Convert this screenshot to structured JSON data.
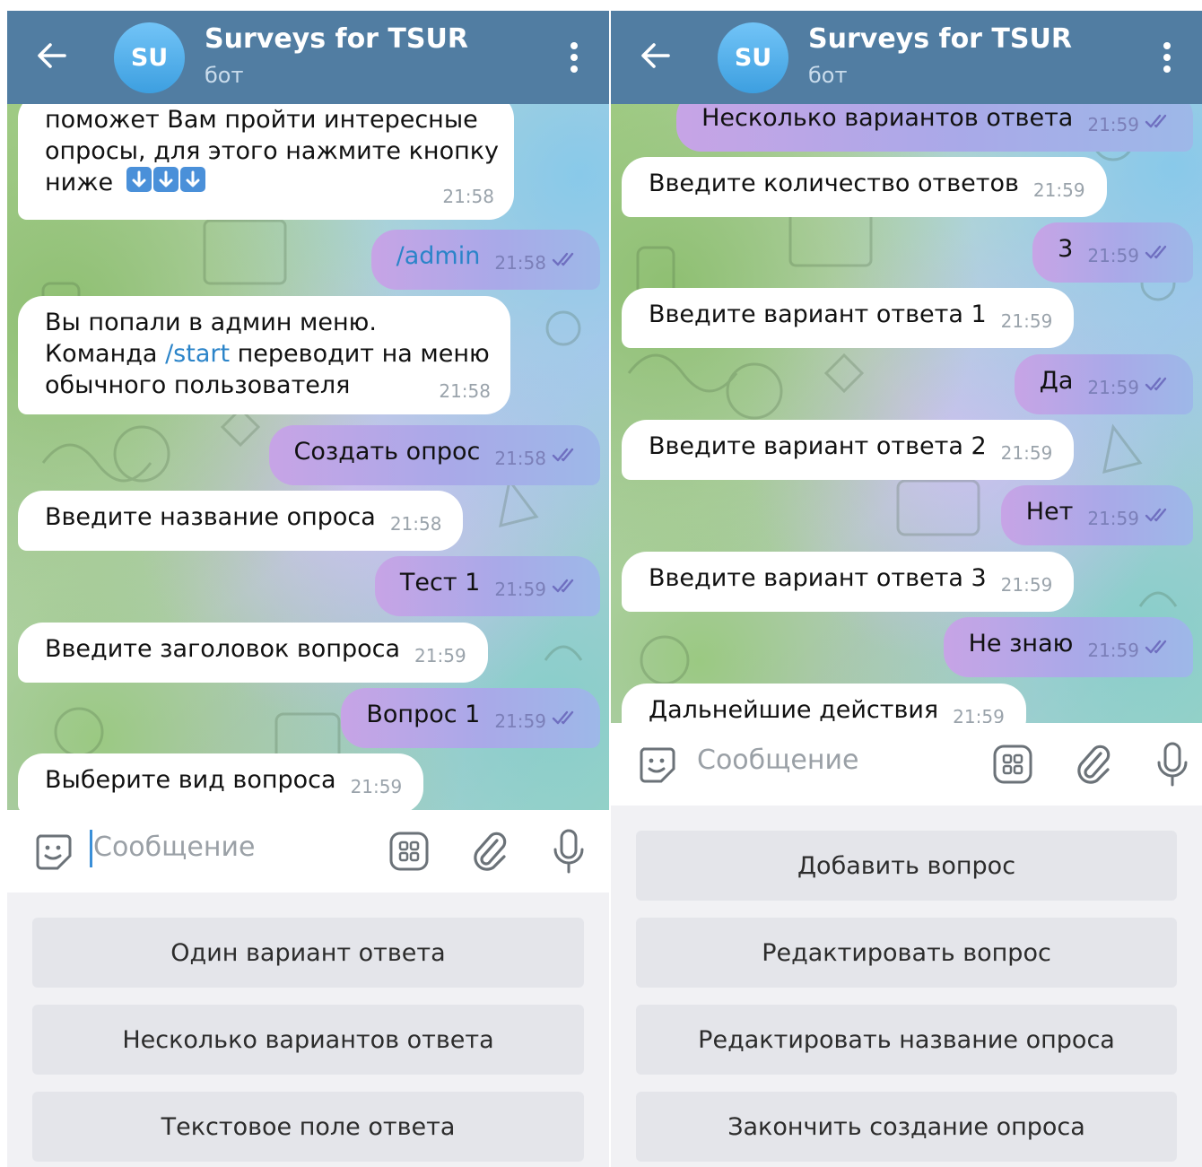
{
  "left": {
    "header": {
      "avatar_initials": "SU",
      "title": "Surveys for TSUR",
      "subtitle": "бот"
    },
    "messages": [
      {
        "dir": "in",
        "lines": [
          "поможет Вам пройти интересные",
          "опросы, для этого нажмите кнопку",
          "ниже"
        ],
        "time": "21:58"
      },
      {
        "dir": "out",
        "text": "/admin",
        "time": "21:58"
      },
      {
        "dir": "in",
        "lines": [
          "Вы попали в админ меню.",
          "Команда",
          "/start",
          "переводит на меню",
          "обычного пользователя"
        ],
        "time": "21:58"
      },
      {
        "dir": "out",
        "text": "Создать опрос",
        "time": "21:58"
      },
      {
        "dir": "in",
        "text": "Введите название опроса",
        "time": "21:58"
      },
      {
        "dir": "out",
        "text": "Тест 1",
        "time": "21:59"
      },
      {
        "dir": "in",
        "text": "Введите заголовок вопроса",
        "time": "21:59"
      },
      {
        "dir": "out",
        "text": "Вопрос 1",
        "time": "21:59"
      },
      {
        "dir": "in",
        "text": "Выберите вид вопроса",
        "time": "21:59"
      }
    ],
    "input": {
      "placeholder": "Сообщение"
    },
    "keyboard": [
      "Один вариант ответа",
      "Несколько вариантов ответа",
      "Текстовое поле ответа"
    ]
  },
  "right": {
    "header": {
      "avatar_initials": "SU",
      "title": "Surveys for TSUR",
      "subtitle": "бот"
    },
    "messages": [
      {
        "dir": "out",
        "text": "Несколько вариантов ответа",
        "time": "21:59"
      },
      {
        "dir": "in",
        "text": "Введите количество ответов",
        "time": "21:59"
      },
      {
        "dir": "out",
        "text": "3",
        "time": "21:59"
      },
      {
        "dir": "in",
        "text": "Введите вариант ответа 1",
        "time": "21:59"
      },
      {
        "dir": "out",
        "text": "Да",
        "time": "21:59"
      },
      {
        "dir": "in",
        "text": "Введите вариант ответа 2",
        "time": "21:59"
      },
      {
        "dir": "out",
        "text": "Нет",
        "time": "21:59"
      },
      {
        "dir": "in",
        "text": "Введите вариант ответа 3",
        "time": "21:59"
      },
      {
        "dir": "out",
        "text": "Не знаю",
        "time": "21:59"
      },
      {
        "dir": "in",
        "text": "Дальнейшие действия",
        "time": "21:59"
      }
    ],
    "input": {
      "placeholder": "Сообщение"
    },
    "keyboard": [
      "Добавить вопрос",
      "Редактировать вопрос",
      "Редактировать название опроса",
      "Закончить создание опроса"
    ]
  },
  "colors": {
    "header": "#517da2",
    "outgoing_bubble": "#b5a8e8",
    "incoming_bubble": "#ffffff",
    "link": "#2b84c9",
    "keyboard_button": "#e4e5ea"
  },
  "icons": [
    "back-arrow-icon",
    "more-vert-icon",
    "sticker-icon",
    "bot-commands-icon",
    "attach-clip-icon",
    "microphone-icon",
    "read-double-check-icon",
    "down-arrow-emoji-icon"
  ]
}
